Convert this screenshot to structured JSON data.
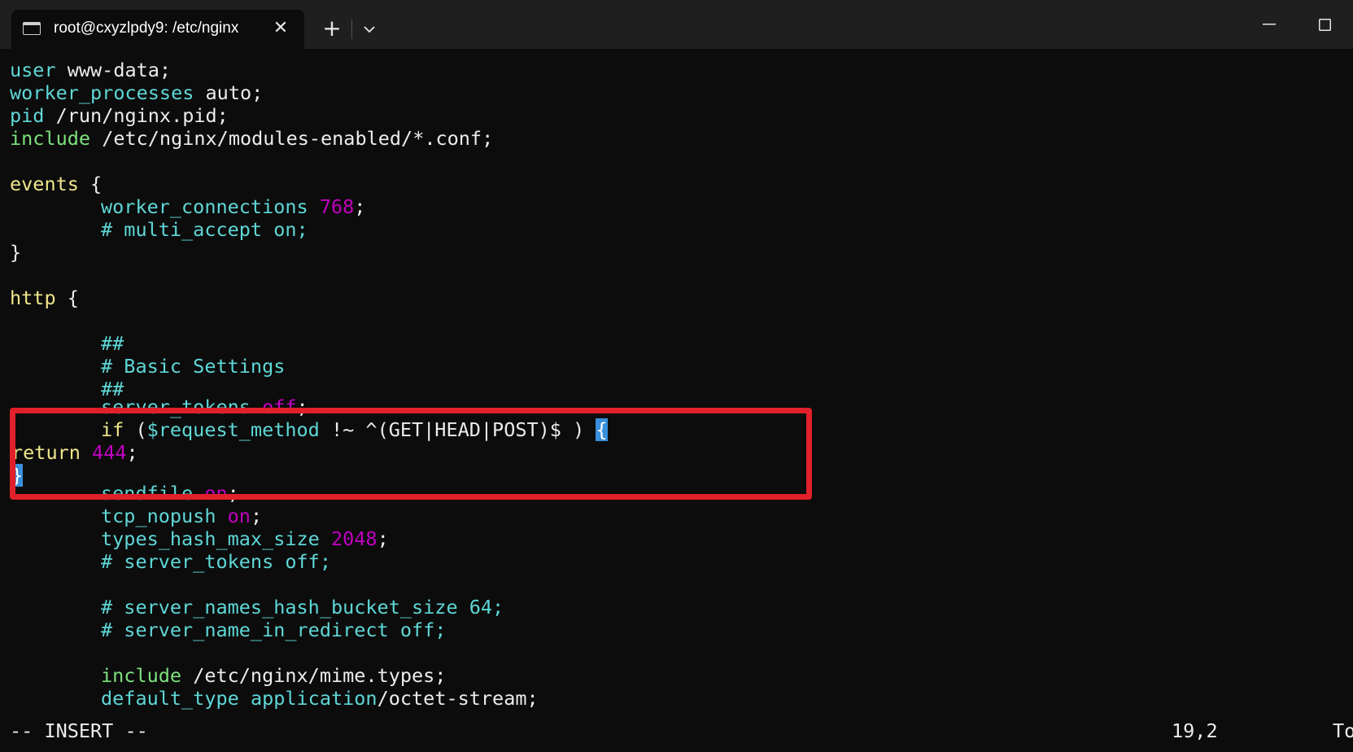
{
  "window": {
    "tab_title": "root@cxyzlpdy9: /etc/nginx",
    "tab_icon": "terminal-icon",
    "new_tab_label": "+",
    "close_label": "✕"
  },
  "lines": [
    {
      "t1": "user",
      "t2": " www-data;"
    },
    {
      "t1": "worker_processes",
      "t2": " auto;"
    },
    {
      "t1": "pid",
      "t2": " /run/nginx.pid;"
    },
    {
      "t1": "include",
      "t2": " /etc/nginx/modules-enabled/*.conf;"
    },
    {
      "t1": "events",
      "t2": " {"
    },
    {
      "t1": "worker_connections",
      "t2": " ",
      "t3": "768",
      "t4": ";"
    },
    {
      "t1": "# multi_accept on;"
    },
    {
      "t1": "}"
    },
    {
      "t1": "http",
      "t2": " {"
    },
    {
      "t1": "##"
    },
    {
      "t1": "# Basic Settings"
    },
    {
      "t1": "##"
    },
    {
      "t1": "server_tokens",
      "t2": " ",
      "t3": "off",
      "t4": ";"
    },
    {
      "t1": "if",
      "t2": " (",
      "t3": "$request_method",
      "t4": " !~ ^(GET|HEAD|POST)$ ) ",
      "t5": "{"
    },
    {
      "t1": "return",
      "t2": " ",
      "t3": "444",
      "t4": ";"
    },
    {
      "t1": "}"
    },
    {
      "t1": "sendfile",
      "t2": " ",
      "t3": "on",
      "t4": ";"
    },
    {
      "t1": "tcp_nopush",
      "t2": " ",
      "t3": "on",
      "t4": ";"
    },
    {
      "t1": "types_hash_max_size",
      "t2": " ",
      "t3": "2048",
      "t4": ";"
    },
    {
      "t1": "# server_tokens off;"
    },
    {
      "t1": "# server_names_hash_bucket_size 64;"
    },
    {
      "t1": "# server_name_in_redirect off;"
    },
    {
      "t1": "include",
      "t2": " /etc/nginx/mime.types;"
    },
    {
      "t1": "default_type",
      "t2": " ",
      "t3": "application",
      "t4": "/octet-stream;"
    }
  ],
  "status": {
    "mode": "-- INSERT --",
    "position": "19,2",
    "scroll": "To"
  },
  "colors": {
    "directive": "#5fd7d7",
    "include": "#7ee07e",
    "block": "#f0e68c",
    "number": "#c000c0",
    "highlight": "#e0202a",
    "cursor": "#3a8fdc"
  }
}
